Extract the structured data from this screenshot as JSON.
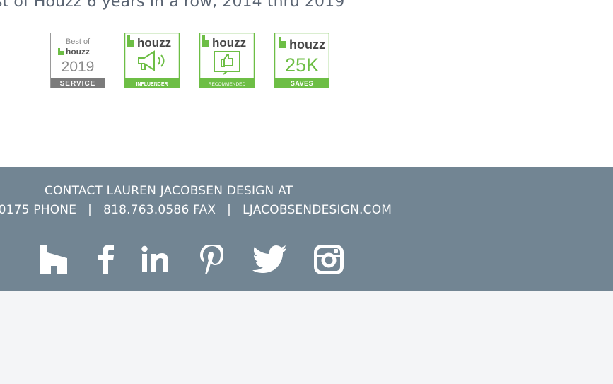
{
  "awards": {
    "heading": "st of Houzz 6 years in a row, 2014 thru 2019",
    "badges": [
      {
        "top_text": "Best of",
        "brand": "houzz",
        "year": "2019",
        "ribbon": "SERVICE"
      },
      {
        "brand": "houzz",
        "ribbon": "INFLUENCER"
      },
      {
        "brand": "houzz",
        "ribbon": "RECOMMENDED"
      },
      {
        "brand": "houzz",
        "value": "25K",
        "ribbon": "SAVES"
      }
    ]
  },
  "contact": {
    "title": "CONTACT LAUREN JACOBSEN DESIGN AT",
    "phone": ".0175 PHONE",
    "separator": "|",
    "fax": "818.763.0586 FAX",
    "website": "LJACOBSENDESIGN.COM"
  },
  "social": {
    "icons": [
      "houzz-icon",
      "facebook-icon",
      "linkedin-icon",
      "pinterest-icon",
      "twitter-icon",
      "instagram-icon"
    ]
  },
  "colors": {
    "footer_bg": "#728593",
    "houzz_green": "#6dbe45",
    "heading_text": "#5a6472",
    "page_bottom": "#f4f5f7"
  }
}
